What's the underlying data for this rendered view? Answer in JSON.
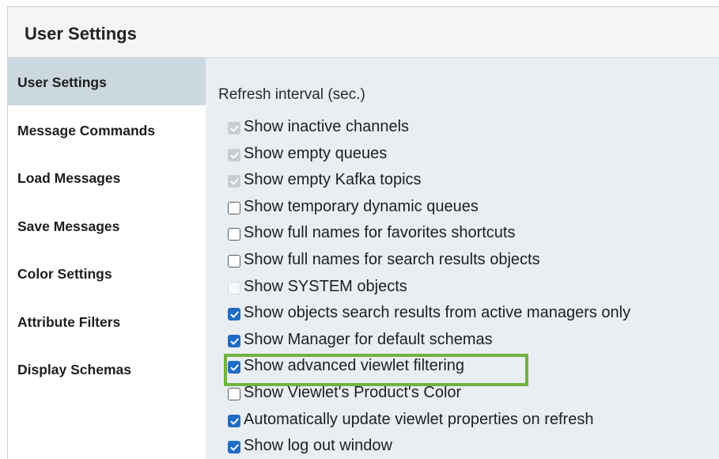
{
  "header": {
    "title": "User Settings"
  },
  "sidebar": {
    "items": [
      {
        "label": "User Settings",
        "active": true
      },
      {
        "label": "Message Commands",
        "active": false
      },
      {
        "label": "Load Messages",
        "active": false
      },
      {
        "label": "Save Messages",
        "active": false
      },
      {
        "label": "Color Settings",
        "active": false
      },
      {
        "label": "Attribute Filters",
        "active": false
      },
      {
        "label": "Display Schemas",
        "active": false
      }
    ]
  },
  "main": {
    "refresh_label": "Refresh interval (sec.)",
    "options": [
      {
        "label": "Show inactive channels",
        "state": "disabled-checked"
      },
      {
        "label": "Show empty queues",
        "state": "disabled-checked"
      },
      {
        "label": "Show empty Kafka topics",
        "state": "disabled-checked"
      },
      {
        "label": "Show temporary dynamic queues",
        "state": "unchecked"
      },
      {
        "label": "Show full names for favorites shortcuts",
        "state": "unchecked"
      },
      {
        "label": "Show full names for search results objects",
        "state": "unchecked"
      },
      {
        "label": "Show SYSTEM objects",
        "state": "disabled-unchecked"
      },
      {
        "label": "Show objects search results from active managers only",
        "state": "checked"
      },
      {
        "label": "Show Manager for default schemas",
        "state": "checked"
      },
      {
        "label": "Show advanced viewlet filtering",
        "state": "checked",
        "highlighted": true
      },
      {
        "label": "Show Viewlet's Product's Color",
        "state": "unchecked"
      },
      {
        "label": "Automatically update viewlet properties on refresh",
        "state": "checked"
      },
      {
        "label": "Show log out window",
        "state": "checked"
      }
    ]
  },
  "colors": {
    "accent": "#1f6cc5",
    "active_nav": "#cbd8e0",
    "highlight_border": "#71b33d",
    "content_bg": "#e9eef3"
  }
}
